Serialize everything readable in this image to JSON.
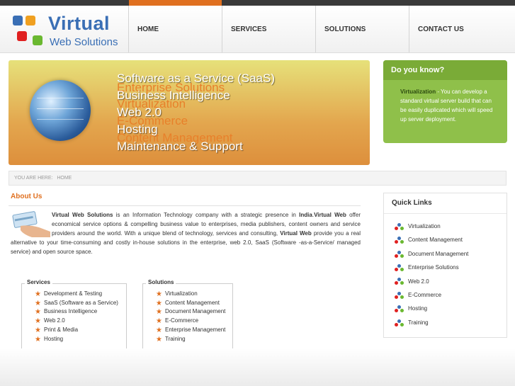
{
  "logo": {
    "line1": "Virtual",
    "line2": "Web Solutions"
  },
  "nav": {
    "items": [
      "HOME",
      "SERVICES",
      "SOLUTIONS",
      "CONTACT US"
    ]
  },
  "banner": {
    "lines": [
      "Software as a Service (SaaS)",
      "Enterprise Solutions",
      "Business Intelligence",
      "Virtualization",
      "Web 2.0",
      "E-Commerce",
      "Hosting",
      "Content Management",
      "Maintenance & Support"
    ]
  },
  "did_you_know": {
    "title": "Do you know?",
    "term": "Virtualization",
    "text": " - You can develop a standard virtual server build that can be easily duplicated which will speed up server deployment."
  },
  "breadcrumb": {
    "label": "YOU ARE HERE:",
    "current": "HOME"
  },
  "about": {
    "title": "About Us",
    "name": "Virtual Web Solutions",
    "p1": " is an Information Technology company with a strategic presence in ",
    "country": "India",
    "p2": ".",
    "name2": "Virtual Web",
    "p3": " offer economical service options & compelling business value to enterprises, media publishers, content owners and service providers around the world. With a unique blend of technology, services and consulting, ",
    "name3": "Virtual Web",
    "p4": " provide you a real alternative to your time-consuming and costly in-house solutions in the enterprise, web 2.0, SaaS (Software -as-a-Service/ managed service) and open source space."
  },
  "services": {
    "title": "Services",
    "items": [
      "Development & Testing",
      "SaaS (Software as a Service)",
      "Business Intelligence",
      "Web 2.0",
      "Print & Media",
      "Hosting"
    ]
  },
  "solutions": {
    "title": "Solutions",
    "items": [
      "Virtualization",
      "Content Management",
      "Document Management",
      "E-Commerce",
      "Enterprise Management",
      "Training"
    ]
  },
  "quick_links": {
    "title": "Quick Links",
    "items": [
      "Virtualization",
      "Content Management",
      "Document Management",
      "Enterprise Solutions",
      "Web 2.0",
      "E-Commerce",
      "Hosting",
      "Training"
    ]
  },
  "colors": {
    "accent": "#e07020",
    "brand": "#3a6fb5",
    "green": "#8fc04a"
  },
  "icons": {
    "list_bullet": "star-icon",
    "quick_link_bullet": "cluster-icon"
  }
}
